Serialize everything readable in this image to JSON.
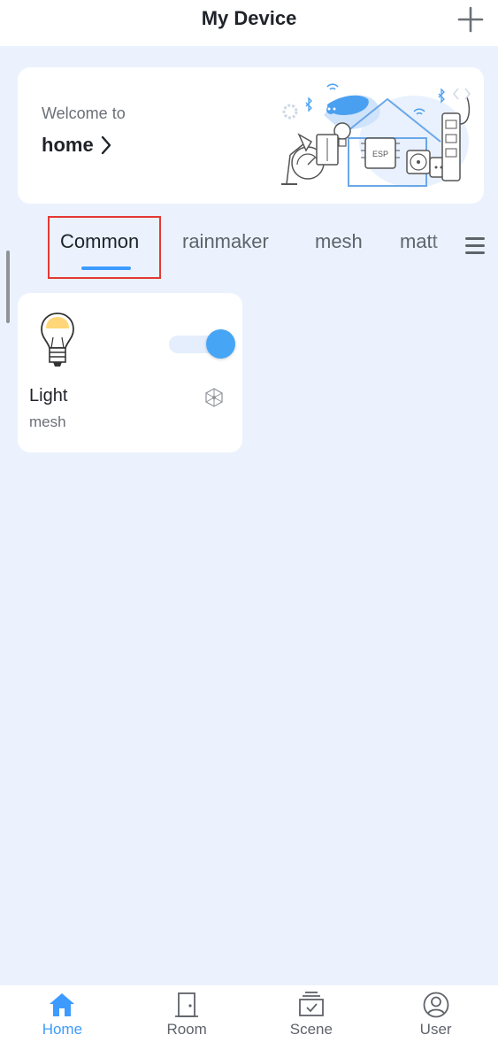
{
  "header": {
    "title": "My Device",
    "add_icon": "plus-icon"
  },
  "banner": {
    "welcome": "Welcome to",
    "home_name": "home",
    "chevron_icon": "chevron-right-icon",
    "illustration": "smart-home-illustration"
  },
  "tabs": {
    "items": [
      {
        "label": "Common",
        "active": true
      },
      {
        "label": "rainmaker",
        "active": false
      },
      {
        "label": "mesh",
        "active": false
      },
      {
        "label": "matt",
        "active": false
      }
    ],
    "menu_icon": "hamburger-menu-icon"
  },
  "devices": [
    {
      "name": "Light",
      "type": "mesh",
      "icon": "light-bulb-icon",
      "badge_icon": "mesh-network-icon",
      "power_on": true
    }
  ],
  "bottom_nav": {
    "items": [
      {
        "label": "Home",
        "icon": "home-icon",
        "active": true
      },
      {
        "label": "Room",
        "icon": "door-icon",
        "active": false
      },
      {
        "label": "Scene",
        "icon": "scene-icon",
        "active": false
      },
      {
        "label": "User",
        "icon": "user-icon",
        "active": false
      }
    ]
  },
  "colors": {
    "accent": "#3d9bff",
    "toggle_on": "#46a6f5",
    "background": "#ebf2fd",
    "highlight_box": "#e53935"
  }
}
